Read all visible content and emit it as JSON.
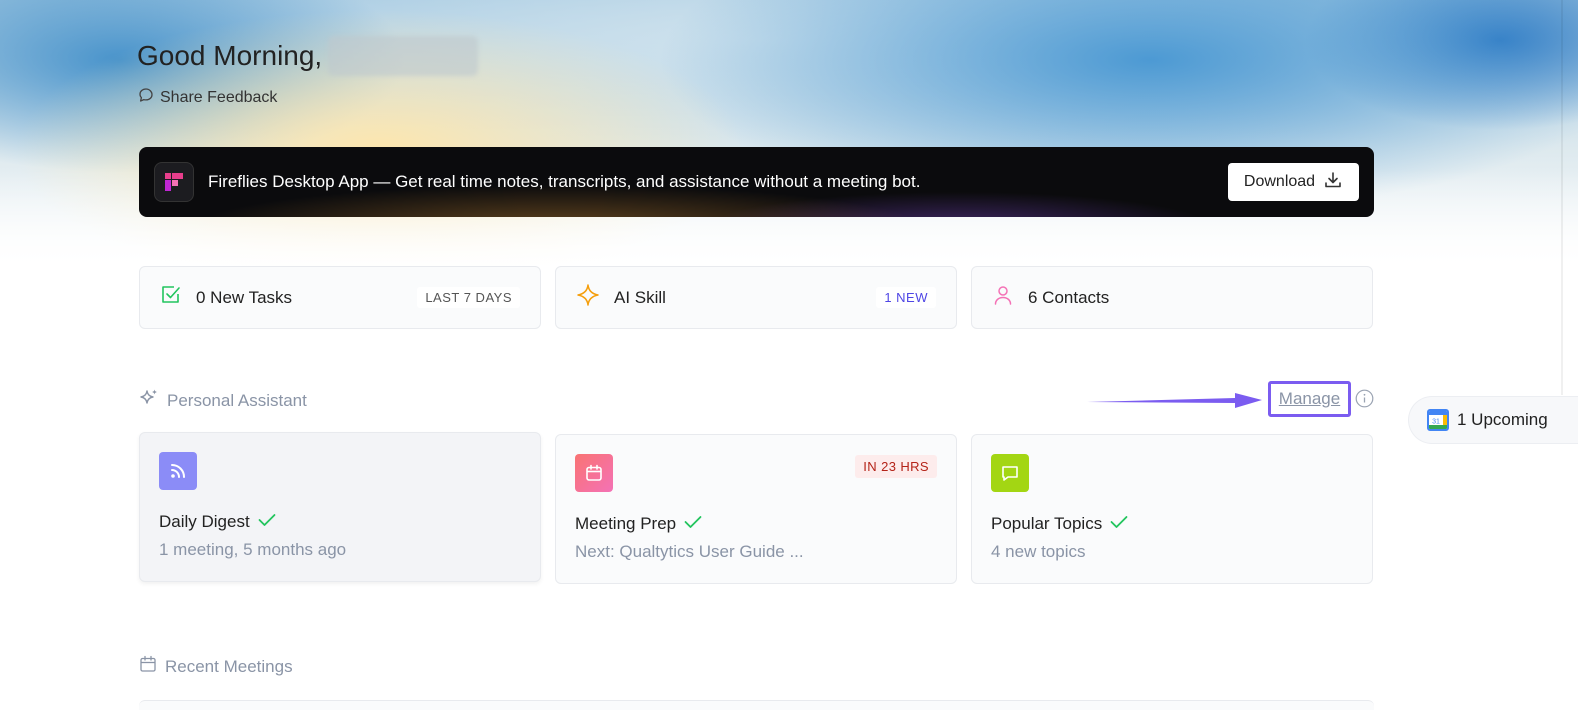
{
  "header": {
    "greeting": "Good Morning,",
    "feedback_label": "Share Feedback"
  },
  "banner": {
    "app_name": "Fireflies Desktop App",
    "tagline": " — Get real time notes, transcripts, and assistance without a meeting bot.",
    "download_label": "Download"
  },
  "stats": [
    {
      "label": "0 New Tasks",
      "badge": "LAST 7 DAYS",
      "icon": "checkbox-icon",
      "color": "#22c55e",
      "badge_color": "#555555"
    },
    {
      "label": "AI Skill",
      "badge": "1 NEW",
      "icon": "sparkle-icon",
      "color": "#f59e0b",
      "badge_color": "#4f46e5"
    },
    {
      "label": "6 Contacts",
      "badge": "",
      "icon": "person-icon",
      "color": "#f472b6"
    }
  ],
  "assistant": {
    "title": "Personal Assistant",
    "manage_label": "Manage",
    "cards": [
      {
        "title": "Daily Digest",
        "subtitle": "1 meeting, 5 months ago",
        "icon": "rss-icon",
        "icon_bg": "#8b8cf7"
      },
      {
        "title": "Meeting Prep",
        "subtitle": "Next: Qualtytics User Guide ...",
        "badge": "IN 23 HRS",
        "icon": "calendar-icon",
        "icon_bg": "#f472b6"
      },
      {
        "title": "Popular Topics",
        "subtitle": "4 new topics",
        "icon": "chat-icon",
        "icon_bg": "#a3d613"
      }
    ]
  },
  "upcoming": {
    "label": "1 Upcoming",
    "icon": "google-calendar-icon",
    "day": "31"
  },
  "recent": {
    "title": "Recent Meetings"
  },
  "colors": {
    "accent": "#7b5cf0",
    "muted": "#8a94a6",
    "check": "#22c55e"
  }
}
